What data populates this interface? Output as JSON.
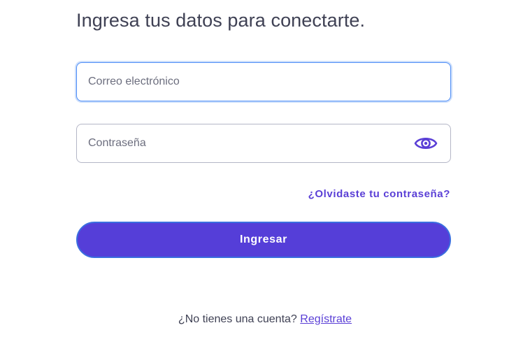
{
  "heading": "Ingresa tus datos para conectarte.",
  "email": {
    "placeholder": "Correo electrónico",
    "value": ""
  },
  "password": {
    "placeholder": "Contraseña",
    "value": "",
    "toggle_icon": "eye-icon"
  },
  "forgot_link": "¿Olvidaste tu contraseña?",
  "submit_label": "Ingresar",
  "signup": {
    "prompt": "¿No tienes una cuenta?",
    "link": "Regístrate"
  },
  "colors": {
    "accent": "#553ed8",
    "link": "#5a3fd6",
    "focus_border": "#4f8ef7",
    "text": "#3f4154"
  }
}
